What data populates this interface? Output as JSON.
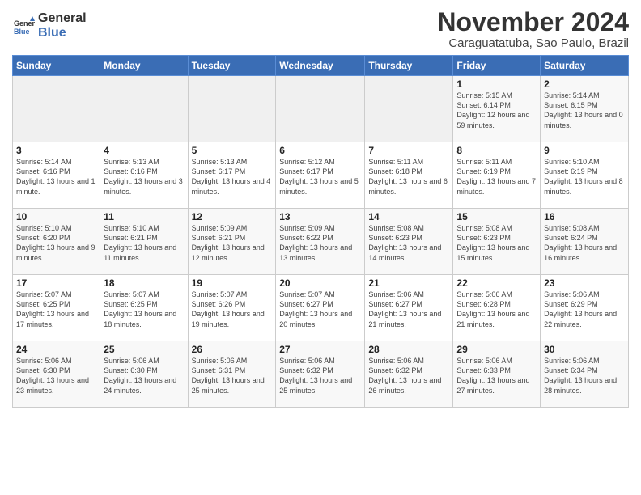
{
  "header": {
    "logo_general": "General",
    "logo_blue": "Blue",
    "month_title": "November 2024",
    "location": "Caraguatatuba, Sao Paulo, Brazil"
  },
  "days_of_week": [
    "Sunday",
    "Monday",
    "Tuesday",
    "Wednesday",
    "Thursday",
    "Friday",
    "Saturday"
  ],
  "weeks": [
    [
      {
        "num": "",
        "info": ""
      },
      {
        "num": "",
        "info": ""
      },
      {
        "num": "",
        "info": ""
      },
      {
        "num": "",
        "info": ""
      },
      {
        "num": "",
        "info": ""
      },
      {
        "num": "1",
        "info": "Sunrise: 5:15 AM\nSunset: 6:14 PM\nDaylight: 12 hours and 59 minutes."
      },
      {
        "num": "2",
        "info": "Sunrise: 5:14 AM\nSunset: 6:15 PM\nDaylight: 13 hours and 0 minutes."
      }
    ],
    [
      {
        "num": "3",
        "info": "Sunrise: 5:14 AM\nSunset: 6:16 PM\nDaylight: 13 hours and 1 minute."
      },
      {
        "num": "4",
        "info": "Sunrise: 5:13 AM\nSunset: 6:16 PM\nDaylight: 13 hours and 3 minutes."
      },
      {
        "num": "5",
        "info": "Sunrise: 5:13 AM\nSunset: 6:17 PM\nDaylight: 13 hours and 4 minutes."
      },
      {
        "num": "6",
        "info": "Sunrise: 5:12 AM\nSunset: 6:17 PM\nDaylight: 13 hours and 5 minutes."
      },
      {
        "num": "7",
        "info": "Sunrise: 5:11 AM\nSunset: 6:18 PM\nDaylight: 13 hours and 6 minutes."
      },
      {
        "num": "8",
        "info": "Sunrise: 5:11 AM\nSunset: 6:19 PM\nDaylight: 13 hours and 7 minutes."
      },
      {
        "num": "9",
        "info": "Sunrise: 5:10 AM\nSunset: 6:19 PM\nDaylight: 13 hours and 8 minutes."
      }
    ],
    [
      {
        "num": "10",
        "info": "Sunrise: 5:10 AM\nSunset: 6:20 PM\nDaylight: 13 hours and 9 minutes."
      },
      {
        "num": "11",
        "info": "Sunrise: 5:10 AM\nSunset: 6:21 PM\nDaylight: 13 hours and 11 minutes."
      },
      {
        "num": "12",
        "info": "Sunrise: 5:09 AM\nSunset: 6:21 PM\nDaylight: 13 hours and 12 minutes."
      },
      {
        "num": "13",
        "info": "Sunrise: 5:09 AM\nSunset: 6:22 PM\nDaylight: 13 hours and 13 minutes."
      },
      {
        "num": "14",
        "info": "Sunrise: 5:08 AM\nSunset: 6:23 PM\nDaylight: 13 hours and 14 minutes."
      },
      {
        "num": "15",
        "info": "Sunrise: 5:08 AM\nSunset: 6:23 PM\nDaylight: 13 hours and 15 minutes."
      },
      {
        "num": "16",
        "info": "Sunrise: 5:08 AM\nSunset: 6:24 PM\nDaylight: 13 hours and 16 minutes."
      }
    ],
    [
      {
        "num": "17",
        "info": "Sunrise: 5:07 AM\nSunset: 6:25 PM\nDaylight: 13 hours and 17 minutes."
      },
      {
        "num": "18",
        "info": "Sunrise: 5:07 AM\nSunset: 6:25 PM\nDaylight: 13 hours and 18 minutes."
      },
      {
        "num": "19",
        "info": "Sunrise: 5:07 AM\nSunset: 6:26 PM\nDaylight: 13 hours and 19 minutes."
      },
      {
        "num": "20",
        "info": "Sunrise: 5:07 AM\nSunset: 6:27 PM\nDaylight: 13 hours and 20 minutes."
      },
      {
        "num": "21",
        "info": "Sunrise: 5:06 AM\nSunset: 6:27 PM\nDaylight: 13 hours and 21 minutes."
      },
      {
        "num": "22",
        "info": "Sunrise: 5:06 AM\nSunset: 6:28 PM\nDaylight: 13 hours and 21 minutes."
      },
      {
        "num": "23",
        "info": "Sunrise: 5:06 AM\nSunset: 6:29 PM\nDaylight: 13 hours and 22 minutes."
      }
    ],
    [
      {
        "num": "24",
        "info": "Sunrise: 5:06 AM\nSunset: 6:30 PM\nDaylight: 13 hours and 23 minutes."
      },
      {
        "num": "25",
        "info": "Sunrise: 5:06 AM\nSunset: 6:30 PM\nDaylight: 13 hours and 24 minutes."
      },
      {
        "num": "26",
        "info": "Sunrise: 5:06 AM\nSunset: 6:31 PM\nDaylight: 13 hours and 25 minutes."
      },
      {
        "num": "27",
        "info": "Sunrise: 5:06 AM\nSunset: 6:32 PM\nDaylight: 13 hours and 25 minutes."
      },
      {
        "num": "28",
        "info": "Sunrise: 5:06 AM\nSunset: 6:32 PM\nDaylight: 13 hours and 26 minutes."
      },
      {
        "num": "29",
        "info": "Sunrise: 5:06 AM\nSunset: 6:33 PM\nDaylight: 13 hours and 27 minutes."
      },
      {
        "num": "30",
        "info": "Sunrise: 5:06 AM\nSunset: 6:34 PM\nDaylight: 13 hours and 28 minutes."
      }
    ]
  ]
}
